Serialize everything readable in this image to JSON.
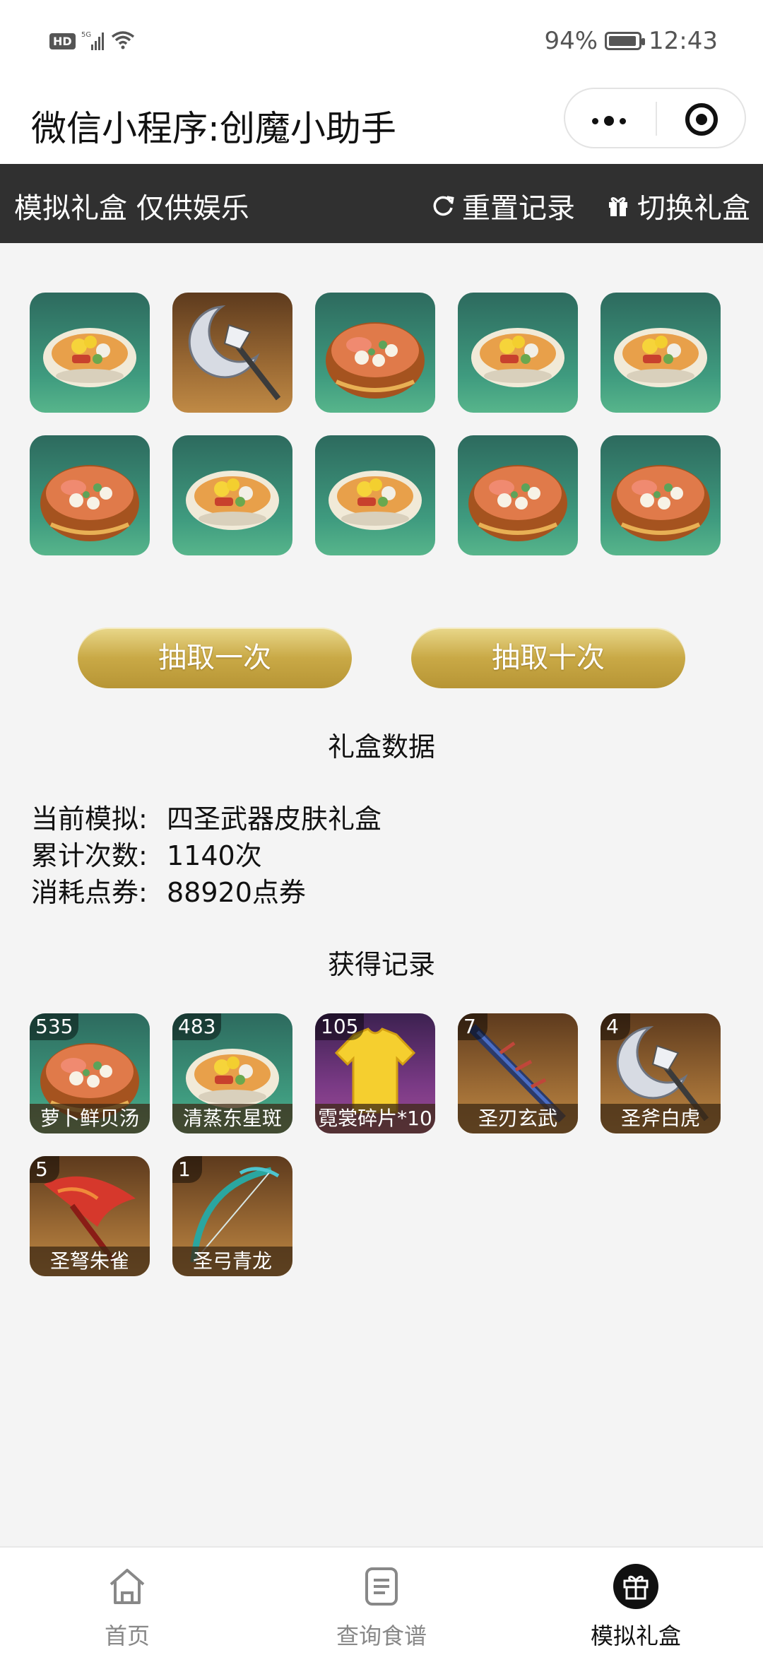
{
  "status_bar": {
    "network": "HD",
    "signal": "5G",
    "battery": "94%",
    "battery_level": 0.94,
    "time": "12:43"
  },
  "titlebar": {
    "title": "微信小程序:创魔小助手"
  },
  "header": {
    "left_text": "模拟礼盒 仅供娱乐",
    "reset_label": "重置记录",
    "switch_label": "切换礼盒"
  },
  "draw_results": [
    {
      "icon": "seafood-soup-icon",
      "bg": "teal"
    },
    {
      "icon": "white-tiger-axe-icon",
      "bg": "brown"
    },
    {
      "icon": "radish-soup-icon",
      "bg": "teal"
    },
    {
      "icon": "seafood-soup-icon",
      "bg": "teal"
    },
    {
      "icon": "seafood-soup-icon",
      "bg": "teal"
    },
    {
      "icon": "radish-soup-icon",
      "bg": "teal"
    },
    {
      "icon": "seafood-soup-icon",
      "bg": "teal"
    },
    {
      "icon": "seafood-soup-icon",
      "bg": "teal"
    },
    {
      "icon": "radish-soup-icon",
      "bg": "teal"
    },
    {
      "icon": "radish-soup-icon",
      "bg": "teal"
    }
  ],
  "buttons": {
    "draw_once": "抽取一次",
    "draw_ten": "抽取十次"
  },
  "stats": {
    "title": "礼盒数据",
    "current_label": "当前模拟:",
    "current_value": "四圣武器皮肤礼盒",
    "count_label": "累计次数:",
    "count_value": "1140次",
    "cost_label": "消耗点券:",
    "cost_value": "88920点券"
  },
  "records": {
    "title": "获得记录",
    "items": [
      {
        "count": "535",
        "name": "萝卜鲜贝汤",
        "icon": "radish-soup-icon",
        "bg": "teal"
      },
      {
        "count": "483",
        "name": "清蒸东星斑",
        "icon": "seafood-soup-icon",
        "bg": "teal"
      },
      {
        "count": "105",
        "name": "霓裳碎片*10",
        "icon": "shirt-icon",
        "bg": "purple"
      },
      {
        "count": "7",
        "name": "圣刃玄武",
        "icon": "sword-icon",
        "bg": "brown"
      },
      {
        "count": "4",
        "name": "圣斧白虎",
        "icon": "white-tiger-axe-icon",
        "bg": "brown"
      },
      {
        "count": "5",
        "name": "圣弩朱雀",
        "icon": "phoenix-crossbow-icon",
        "bg": "brown"
      },
      {
        "count": "1",
        "name": "圣弓青龙",
        "icon": "dragon-bow-icon",
        "bg": "brown"
      }
    ]
  },
  "tabbar": {
    "tabs": [
      {
        "label": "首页",
        "icon": "home-icon"
      },
      {
        "label": "查询食谱",
        "icon": "recipe-icon"
      },
      {
        "label": "模拟礼盒",
        "icon": "gift-icon",
        "active": true
      }
    ]
  }
}
